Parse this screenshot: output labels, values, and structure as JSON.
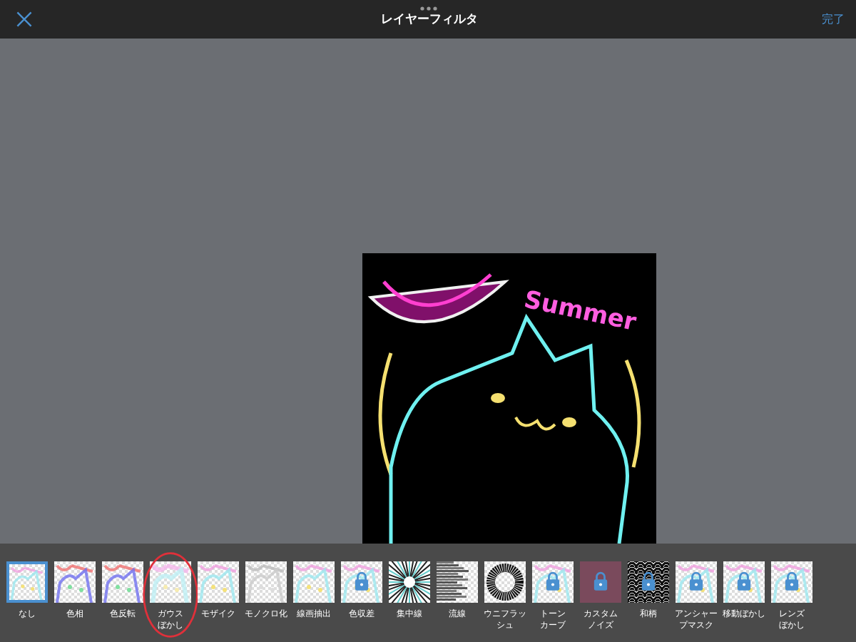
{
  "header": {
    "title": "レイヤーフィルタ",
    "done": "完了"
  },
  "canvas": {
    "artwork_text": "Summer"
  },
  "filters": [
    {
      "lines": [
        "なし"
      ],
      "selected": true,
      "locked": false,
      "kind": "sketch",
      "circled": false
    },
    {
      "lines": [
        "色相"
      ],
      "selected": false,
      "locked": false,
      "kind": "hue",
      "circled": false
    },
    {
      "lines": [
        "色反転"
      ],
      "selected": false,
      "locked": false,
      "kind": "invert",
      "circled": false
    },
    {
      "lines": [
        "ガウス",
        "ぼかし"
      ],
      "selected": false,
      "locked": false,
      "kind": "blur",
      "circled": true
    },
    {
      "lines": [
        "モザイク"
      ],
      "selected": false,
      "locked": false,
      "kind": "sketch",
      "circled": false
    },
    {
      "lines": [
        "モノクロ化"
      ],
      "selected": false,
      "locked": false,
      "kind": "mono",
      "circled": false
    },
    {
      "lines": [
        "線画抽出"
      ],
      "selected": false,
      "locked": false,
      "kind": "sketch",
      "circled": false
    },
    {
      "lines": [
        "色収差"
      ],
      "selected": false,
      "locked": true,
      "kind": "sketch",
      "circled": false
    },
    {
      "lines": [
        "集中線"
      ],
      "selected": false,
      "locked": false,
      "kind": "burst",
      "circled": false
    },
    {
      "lines": [
        "流線"
      ],
      "selected": false,
      "locked": false,
      "kind": "streak",
      "circled": false
    },
    {
      "lines": [
        "ウニフラッ",
        "シュ"
      ],
      "selected": false,
      "locked": false,
      "kind": "urchin",
      "circled": false
    },
    {
      "lines": [
        "トーン",
        "カーブ"
      ],
      "selected": false,
      "locked": true,
      "kind": "sketch",
      "circled": false
    },
    {
      "lines": [
        "カスタム",
        "ノイズ"
      ],
      "selected": false,
      "locked": true,
      "kind": "noise",
      "circled": false
    },
    {
      "lines": [
        "和柄"
      ],
      "selected": false,
      "locked": true,
      "kind": "pattern",
      "circled": false
    },
    {
      "lines": [
        "アンシャー",
        "プマスク"
      ],
      "selected": false,
      "locked": true,
      "kind": "sketch",
      "circled": false
    },
    {
      "lines": [
        "移動ぼかし"
      ],
      "selected": false,
      "locked": true,
      "kind": "sketch",
      "circled": false
    },
    {
      "lines": [
        "レンズ",
        "ぼかし"
      ],
      "selected": false,
      "locked": true,
      "kind": "sketch",
      "circled": false
    }
  ]
}
